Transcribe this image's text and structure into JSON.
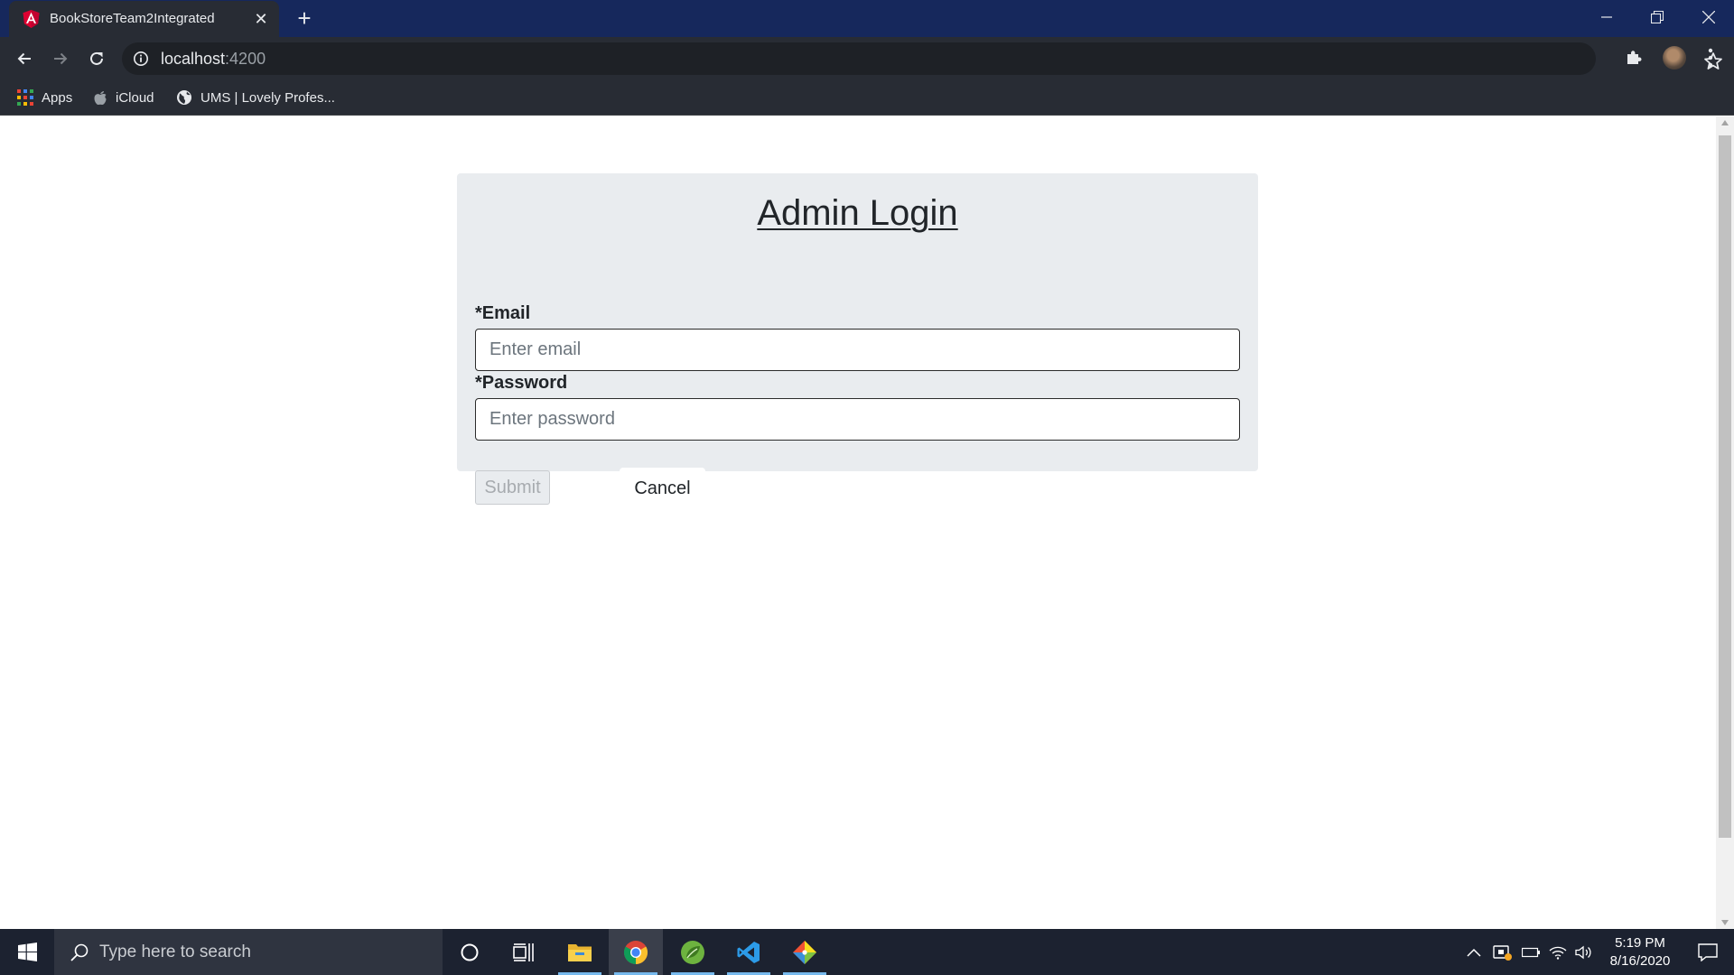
{
  "browser": {
    "tab_title": "BookStoreTeam2Integrated",
    "new_tab_symbol": "+",
    "url_host": "localhost",
    "url_port": ":4200",
    "bookmarks": [
      {
        "label": "Apps",
        "icon": "apps-grid-icon"
      },
      {
        "label": "iCloud",
        "icon": "apple-icon"
      },
      {
        "label": "UMS | Lovely Profes...",
        "icon": "globe-icon"
      }
    ],
    "accent_color": "#16285c"
  },
  "login": {
    "title": "Admin Login",
    "email_label": "*Email",
    "email_placeholder": "Enter email",
    "password_label": "*Password",
    "password_placeholder": "Enter password",
    "submit_label": "Submit",
    "cancel_label": "Cancel",
    "submit_disabled": true
  },
  "taskbar": {
    "search_placeholder": "Type here to search",
    "time": "5:19 PM",
    "date": "8/16/2020",
    "pinned_apps": [
      "cortana-icon",
      "task-view-icon",
      "file-explorer-icon",
      "chrome-icon",
      "spring-tool-suite-icon",
      "vscode-icon",
      "git-icon"
    ]
  }
}
